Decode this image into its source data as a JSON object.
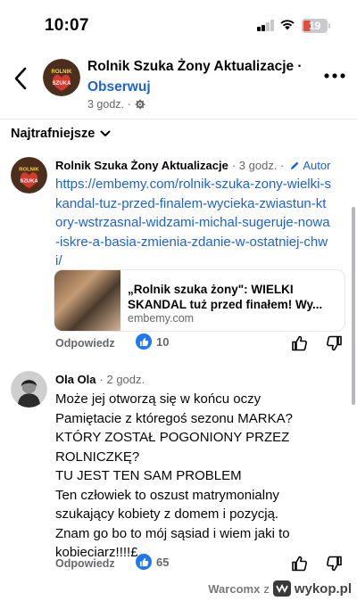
{
  "status_bar": {
    "time": "10:07",
    "battery": "19"
  },
  "header": {
    "page_name": "Rolnik Szuka Żony Aktualizacje ·",
    "follow_label": "Obserwuj",
    "time": "3 godz. ·",
    "avatar_text_top": "ROLNIK",
    "avatar_text_bottom": "SZUKA"
  },
  "sort": {
    "label": "Najtrafniejsze"
  },
  "comments": [
    {
      "author": "Rolnik Szuka Żony Aktualizacje",
      "time": "· 3 godz. ·",
      "badge": "Autor",
      "link": "https://embemy.com/rolnik-szuka-zony-wielki-skandal-tuz-przed-finalem-wycieka-zwiastun-ktory-wstrzasnal-widzami-michal-sugeruje-nowa-iskre-a-basia-zmienia-zdanie-w-ostatniej-chwi/",
      "preview": {
        "title": "„Rolnik szuka żony\": WIELKI SKANDAL tuż przed finałem! Wy...",
        "domain": "embemy.com"
      },
      "reply_label": "Odpowiedz",
      "reactions": "10"
    },
    {
      "author": "Ola Ola",
      "time": "· 2 godz.",
      "text_lines": [
        "Może jej otworzą się w końcu oczy",
        "Pamiętacie z któregoś sezonu MARKA?",
        "KTÓRY ZOSTAŁ POGONIONY PRZEZ",
        "ROLNICZKĘ?",
        "TU JEST TEN SAM PROBLEM",
        "Ten człowiek to oszust matrymonialny",
        "szukający kobiety z domem i pozycją.",
        "Znam go bo to mój sąsiad i wiem jaki to",
        "kobieciarz!!!!£"
      ],
      "reply_label": "Odpowiedz",
      "reactions": "65"
    }
  ],
  "watermark": {
    "user": "Warcomx",
    "separator": "z",
    "brand": "wykop.pl"
  },
  "colors": {
    "link_blue": "#1d62d8",
    "like_blue": "#1f77f2",
    "secondary_text": "#65676b",
    "battery_red": "#e5483d"
  },
  "icons": [
    "back-chevron-icon",
    "more-dots-icon",
    "globe-settings-icon",
    "chevron-down-icon",
    "pencil-icon",
    "like-icon",
    "thumb-up-icon",
    "thumb-down-icon"
  ]
}
